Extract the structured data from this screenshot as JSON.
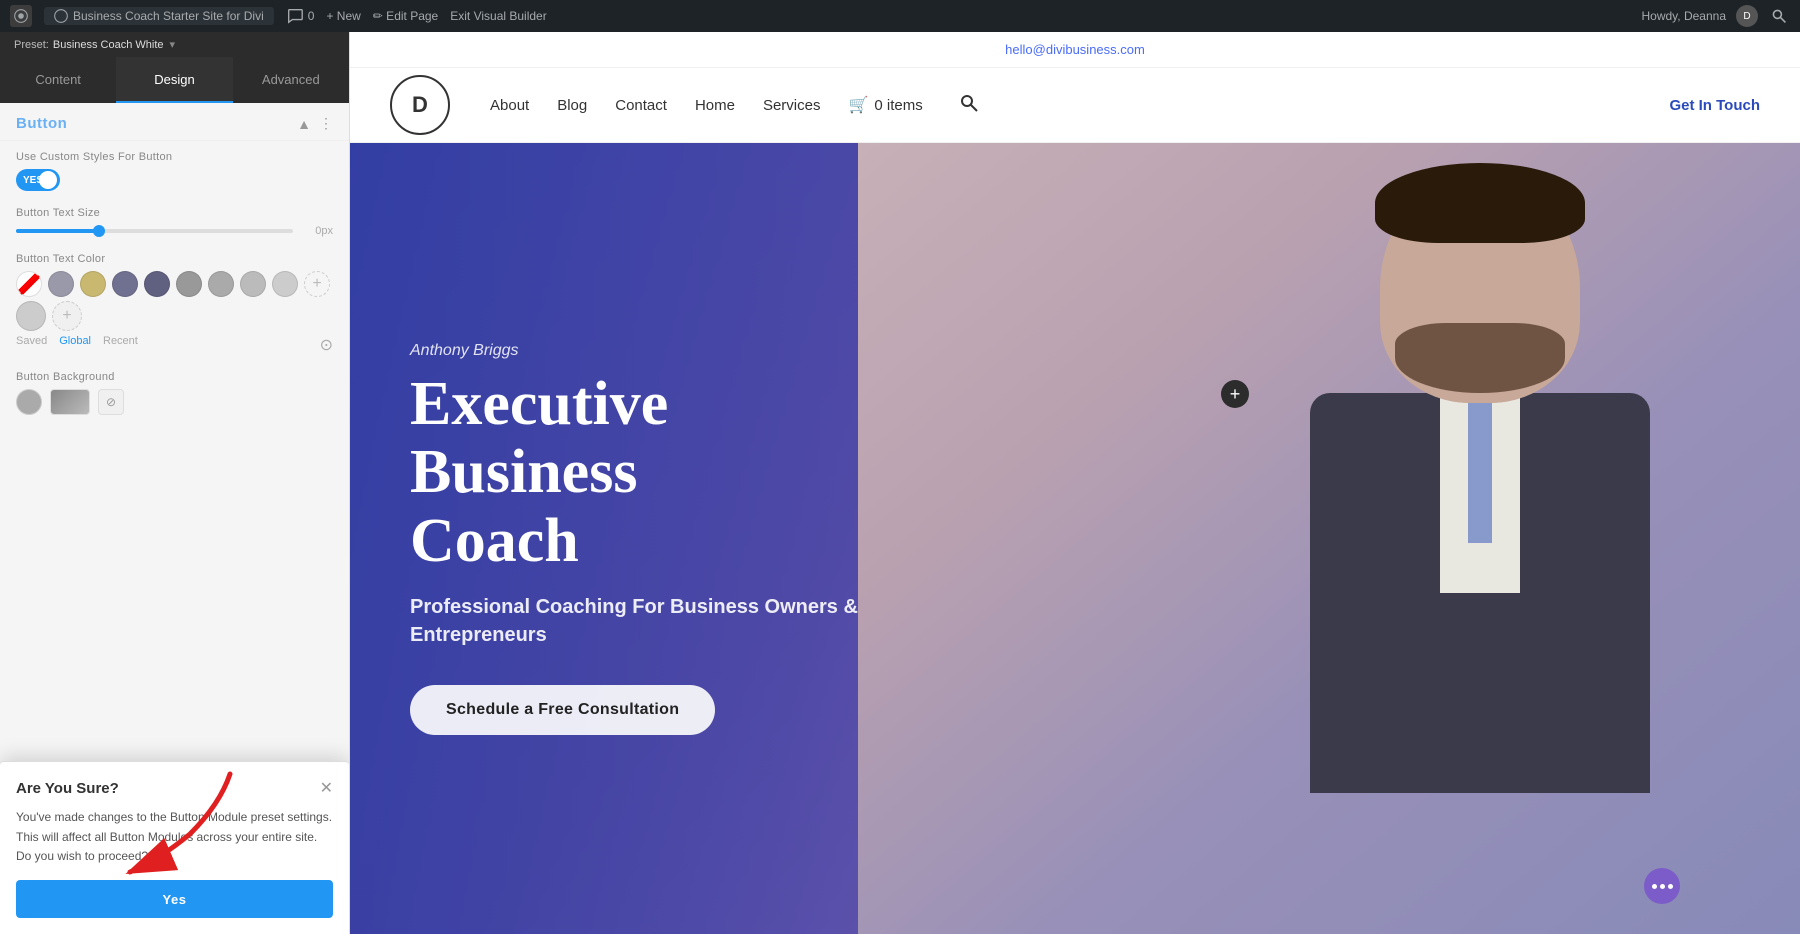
{
  "admin_bar": {
    "wp_label": "W",
    "site_name": "Business Coach Starter Site for Divi",
    "comment_count": "0",
    "new_label": "+ New",
    "edit_page_label": "✏ Edit Page",
    "exit_vb_label": "Exit Visual Builder",
    "howdy_label": "Howdy, Deanna",
    "search_icon": "search"
  },
  "left_panel": {
    "preset_text": "Preset:",
    "preset_name": "Business Coach White",
    "tabs": [
      {
        "label": "Content",
        "active": false
      },
      {
        "label": "Design",
        "active": true
      },
      {
        "label": "Advanced",
        "active": false
      }
    ],
    "section_title": "Button",
    "fields": {
      "custom_styles_label": "Use Custom Styles For Button",
      "toggle_state": "on",
      "toggle_label": "YES",
      "button_text_size_label": "Button Text Size",
      "button_text_size_unit": "0px",
      "button_text_color_label": "Button Text Color",
      "color_swatches": [
        {
          "color": "transparent",
          "type": "transparent"
        },
        {
          "color": "#8a8a9a"
        },
        {
          "color": "#b8a860"
        },
        {
          "color": "#6a6a8a"
        },
        {
          "color": "#5a5a70"
        },
        {
          "color": "#888888"
        },
        {
          "color": "#999999"
        },
        {
          "color": "#aaaaaa"
        },
        {
          "color": "#cccccc"
        },
        {
          "color": "add",
          "type": "add"
        }
      ],
      "preset_options": [
        "Saved",
        "Global",
        "Recent"
      ],
      "active_preset": "Global",
      "button_background_label": "Button Background"
    },
    "bg_swatches": [
      {
        "type": "circle"
      },
      {
        "type": "gradient"
      },
      {
        "type": "transparent"
      }
    ]
  },
  "confirm_dialog": {
    "title": "Are You Sure?",
    "body": "You've made changes to the Button Module preset settings. This will affect all Button Modules across your entire site. Do you wish to proceed?",
    "yes_label": "Yes"
  },
  "site": {
    "email": "hello@divibusiness.com",
    "logo_letter": "D",
    "nav_links": [
      "About",
      "Blog",
      "Contact",
      "Home",
      "Services"
    ],
    "cart_label": "0 items",
    "cta_label": "Get In Touch"
  },
  "hero": {
    "subtitle": "Anthony Briggs",
    "title_line1": "Executive Business",
    "title_line2": "Coach",
    "tagline": "Professional Coaching For Business Owners &\nEntrepreneurs",
    "cta_button": "Schedule a Free Consultation",
    "plus_icon": "+",
    "dots_label": "•••"
  },
  "colors": {
    "accent_blue": "#2196f3",
    "nav_cta": "#2b4bbb",
    "hero_bg_start": "#3a4db7",
    "hero_bg_end": "#9b7ec8",
    "purple_dot": "#7b5cc8"
  }
}
